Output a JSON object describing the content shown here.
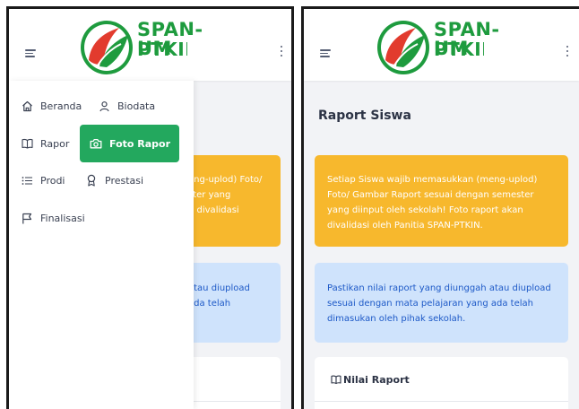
{
  "logo": {
    "line1": "SPAN-UM",
    "line2": "PTKIN"
  },
  "colors": {
    "brand_green": "#1e9b3e",
    "active_green": "#23a85e",
    "warning": "#f7b82d",
    "info_bg": "#cfe3fc",
    "info_text": "#1d59c7"
  },
  "drawer": {
    "items": [
      {
        "label": "Beranda",
        "icon": "home-icon"
      },
      {
        "label": "Biodata",
        "icon": "user-icon"
      },
      {
        "label": "Rapor",
        "icon": "book-icon"
      },
      {
        "label": "Foto Rapor",
        "icon": "camera-icon",
        "active": true
      },
      {
        "label": "Prodi",
        "icon": "list-icon"
      },
      {
        "label": "Prestasi",
        "icon": "award-icon"
      },
      {
        "label": "Finalisasi",
        "icon": "flag-icon"
      }
    ]
  },
  "page": {
    "title": "Raport Siswa",
    "warning_text": "Setiap Siswa wajib memasukkan (meng-uplod) Foto/ Gambar Raport sesuai dengan semester yang diinput oleh sekolah! Foto raport akan divalidasi oleh Panitia SPAN-PTKIN.",
    "info_text": "Pastikan nilai raport yang diunggah atau diupload sesuai dengan mata pelajaran yang ada telah dimasukan oleh pihak sekolah.",
    "card_title": "Nilai Raport"
  },
  "left_partial": {
    "warning_lines": [
      "eng-uplod) Foto/",
      "ster yang",
      "n divalidasi"
    ],
    "info_lines": [
      "atau diupload",
      "ada telah"
    ]
  }
}
